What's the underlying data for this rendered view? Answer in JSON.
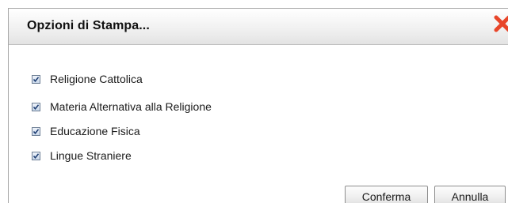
{
  "dialog": {
    "title": "Opzioni di Stampa...",
    "close_icon": "close-icon",
    "close_color": "#e8462a",
    "options": [
      {
        "label": "Religione Cattolica",
        "checked": true
      },
      {
        "label": "Materia Alternativa alla Religione",
        "checked": true
      },
      {
        "label": "Educazione Fisica",
        "checked": true
      },
      {
        "label": "Lingue Straniere",
        "checked": true
      }
    ],
    "buttons": {
      "confirm_label": "Conferma",
      "cancel_label": "Annulla"
    }
  }
}
